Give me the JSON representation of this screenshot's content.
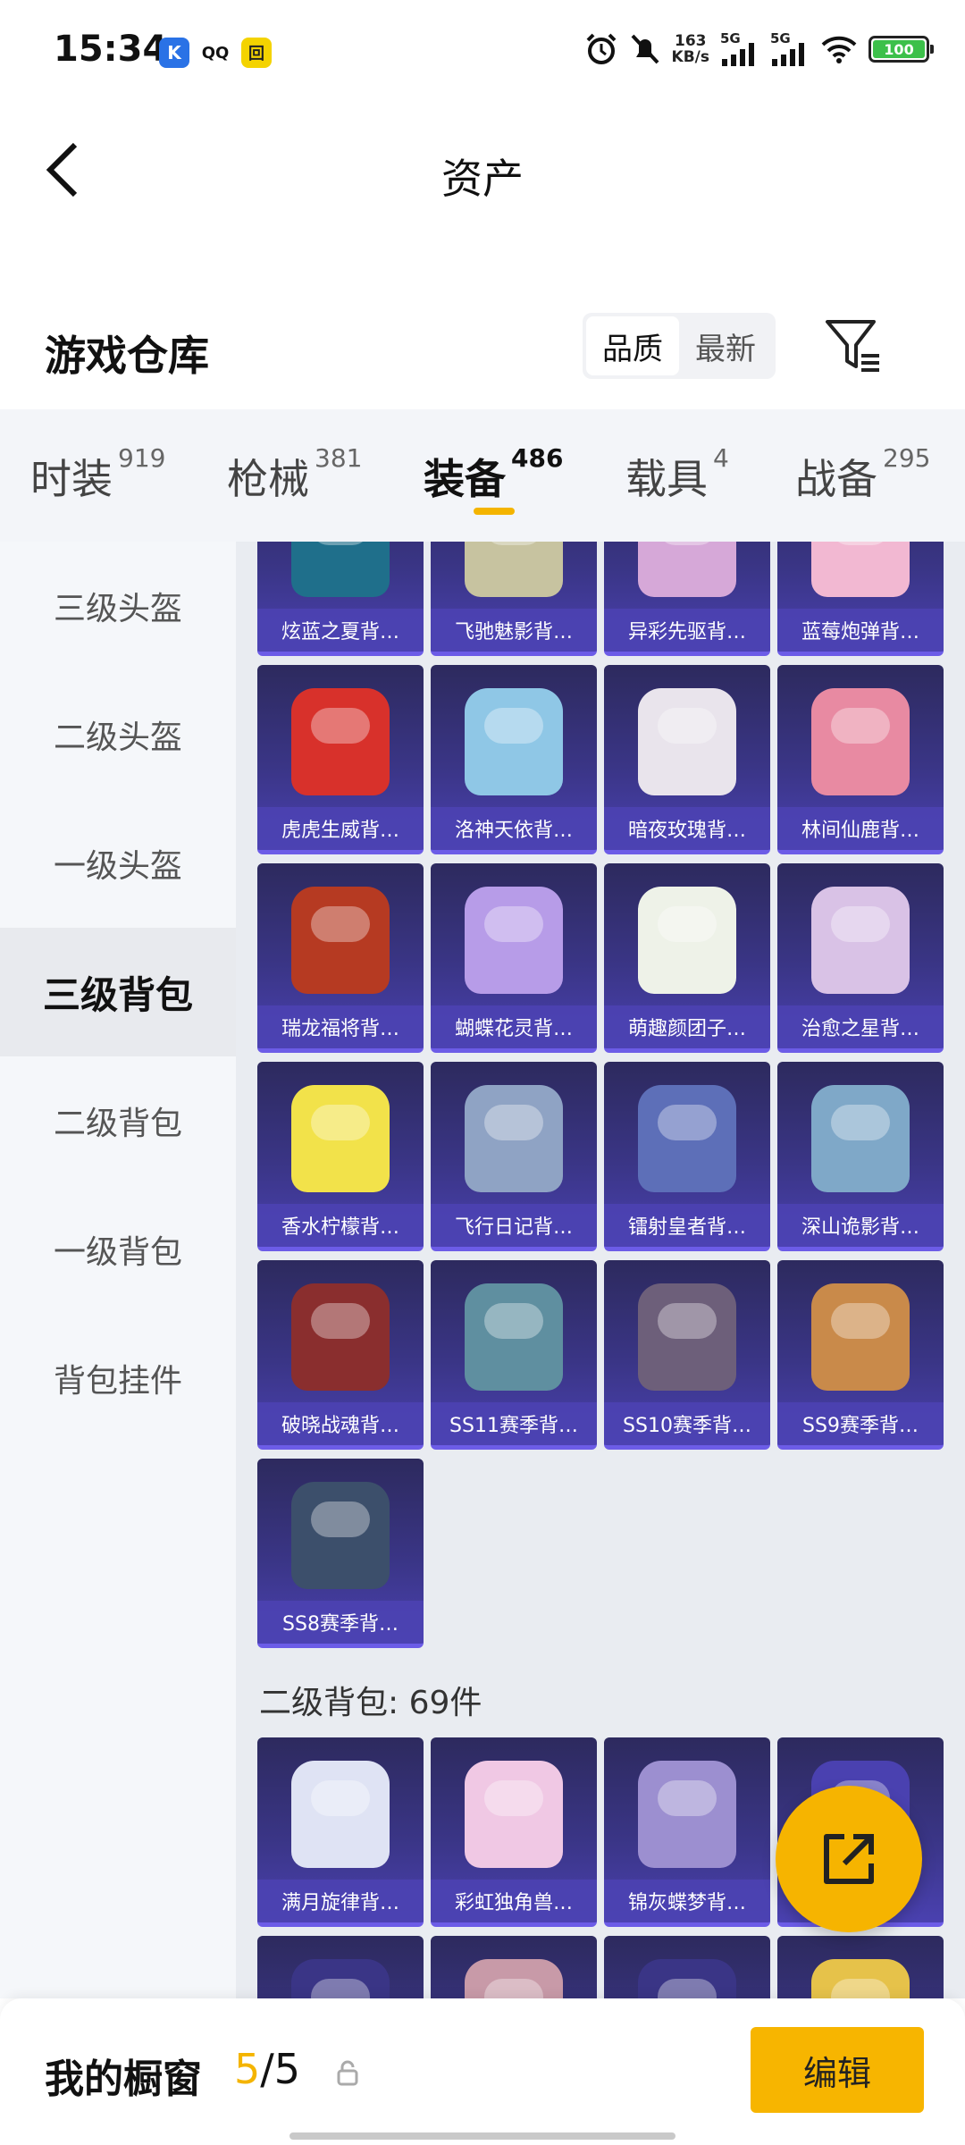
{
  "status_bar": {
    "time": "15:34",
    "apps": [
      "K",
      "QQ",
      "回"
    ],
    "net_speed_value": "163",
    "net_speed_unit": "KB/s",
    "signal1": "5G",
    "signal2": "5G",
    "battery": "100"
  },
  "header": {
    "title": "资产"
  },
  "warehouse": {
    "title": "游戏仓库",
    "sort_options": [
      "品质",
      "最新"
    ],
    "sort_selected": "品质"
  },
  "tabs": [
    {
      "label": "时装",
      "count": "919"
    },
    {
      "label": "枪械",
      "count": "381"
    },
    {
      "label": "装备",
      "count": "486",
      "active": true
    },
    {
      "label": "载具",
      "count": "4"
    },
    {
      "label": "战备",
      "count": "295"
    }
  ],
  "sidebar": {
    "items": [
      {
        "label": "三级头盔"
      },
      {
        "label": "二级头盔"
      },
      {
        "label": "一级头盔"
      },
      {
        "label": "三级背包",
        "active": true
      },
      {
        "label": "二级背包"
      },
      {
        "label": "一级背包"
      },
      {
        "label": "背包挂件"
      }
    ]
  },
  "grid": {
    "level3_items": [
      {
        "name": "炫蓝之夏背…",
        "color": "#1f6f8b"
      },
      {
        "name": "飞驰魅影背…",
        "color": "#c7c3a0"
      },
      {
        "name": "异彩先驱背…",
        "color": "#d6a8d8"
      },
      {
        "name": "蓝莓炮弹背…",
        "color": "#f2b8d2"
      },
      {
        "name": "虎虎生威背…",
        "color": "#d8312b"
      },
      {
        "name": "洛神天依背…",
        "color": "#8fc7e6"
      },
      {
        "name": "暗夜玫瑰背…",
        "color": "#e9e4ec"
      },
      {
        "name": "林间仙鹿背…",
        "color": "#e88aa2"
      },
      {
        "name": "瑞龙福将背…",
        "color": "#b63a22"
      },
      {
        "name": "蝴蝶花灵背…",
        "color": "#b79ce8"
      },
      {
        "name": "萌趣颜团子…",
        "color": "#eef2e8"
      },
      {
        "name": "治愈之星背…",
        "color": "#d9c2e6"
      },
      {
        "name": "香水柠檬背…",
        "color": "#f2e24a"
      },
      {
        "name": "飞行日记背…",
        "color": "#8fa3c4"
      },
      {
        "name": "镭射皇者背…",
        "color": "#5d6fb8"
      },
      {
        "name": "深山诡影背…",
        "color": "#7fa8c8"
      },
      {
        "name": "破晓战魂背…",
        "color": "#8a2e2e"
      },
      {
        "name": "SS11赛季背…",
        "color": "#5f8fa0"
      },
      {
        "name": "SS10赛季背…",
        "color": "#6d5f7a"
      },
      {
        "name": "SS9赛季背…",
        "color": "#c98a4a"
      },
      {
        "name": "SS8赛季背…",
        "color": "#3c4f6b"
      }
    ],
    "section_title": "二级背包: 69件",
    "level2_items": [
      {
        "name": "满月旋律背…",
        "color": "#dfe3f4"
      },
      {
        "name": "彩虹独角兽…",
        "color": "#f0c8e4"
      },
      {
        "name": "锦灰蝶梦背…",
        "color": "#9c8fd0"
      },
      {
        "name": "",
        "color": "#4a41b0"
      }
    ],
    "level2_next_row_colors": [
      "#3a3586",
      "#c89aa8",
      "#3a3586",
      "#e6c24a"
    ]
  },
  "share_icon": "share-external-icon",
  "bottom_bar": {
    "showcase_label": "我的橱窗",
    "count_current": "5",
    "count_separator": "/",
    "count_total": "5",
    "edit_label": "编辑"
  }
}
